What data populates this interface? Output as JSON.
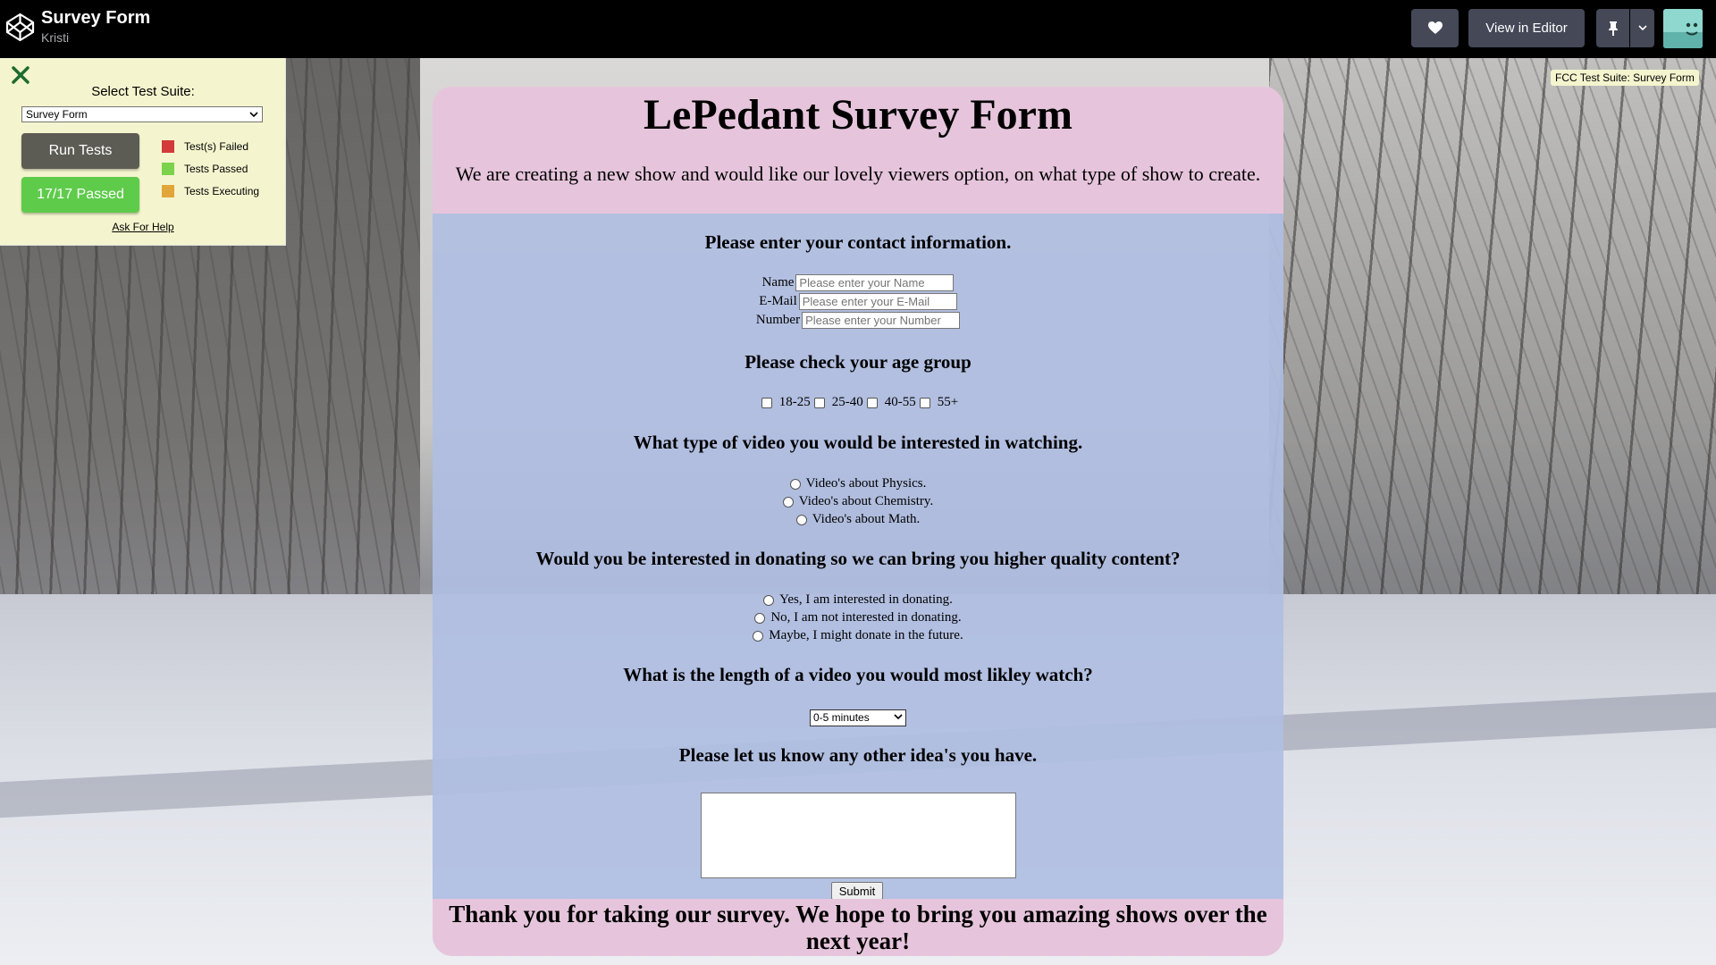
{
  "topbar": {
    "title": "Survey Form",
    "author": "Kristi",
    "view_in_editor": "View in Editor",
    "heart_icon": "heart-icon",
    "pin_icon": "pin-icon",
    "caret_icon": "chevron-down-icon"
  },
  "fcc": {
    "select_label": "Select Test Suite:",
    "selected_suite": "Survey Form",
    "run_tests": "Run Tests",
    "passed": "17/17 Passed",
    "legend": [
      {
        "label": "Test(s) Failed",
        "color": "#d33a3a"
      },
      {
        "label": "Tests Passed",
        "color": "#7cd24a"
      },
      {
        "label": "Tests Executing",
        "color": "#e2a53a"
      }
    ],
    "help": "Ask For Help",
    "tag": "FCC Test Suite: Survey Form"
  },
  "form": {
    "title": "LePedant Survey Form",
    "description": "We are creating a new show and would like our lovely viewers option, on what type of show to create.",
    "contact_heading": "Please enter your contact information.",
    "name_label": "Name",
    "name_placeholder": "Please enter your Name",
    "email_label": "E-Mail",
    "email_placeholder": "Please enter your E-Mail",
    "number_label": "Number",
    "number_placeholder": "Please enter your Number",
    "age_heading": "Please check your age group",
    "ages": [
      "18-25",
      "25-40",
      "40-55",
      "55+"
    ],
    "video_heading": "What type of video you would be interested in watching.",
    "videos": [
      "Video's about Physics.",
      "Video's about Chemistry.",
      "Video's about Math."
    ],
    "donate_heading": "Would you be interested in donating so we can bring you higher quality content?",
    "donate_options": [
      "Yes, I am interested in donating.",
      "No, I am not interested in donating.",
      "Maybe, I might donate in the future."
    ],
    "length_heading": "What is the length of a video you would most likley watch?",
    "length_selected": "0-5 minutes",
    "ideas_heading": "Please let us know any other idea's you have.",
    "submit": "Submit",
    "footer": "Thank you for taking our survey. We hope to bring you amazing shows over the next year!"
  },
  "colors": {
    "header_bg": "#e6c5dc",
    "body_bg": "#b0bee2",
    "panel_bg": "#f4f5ce"
  }
}
